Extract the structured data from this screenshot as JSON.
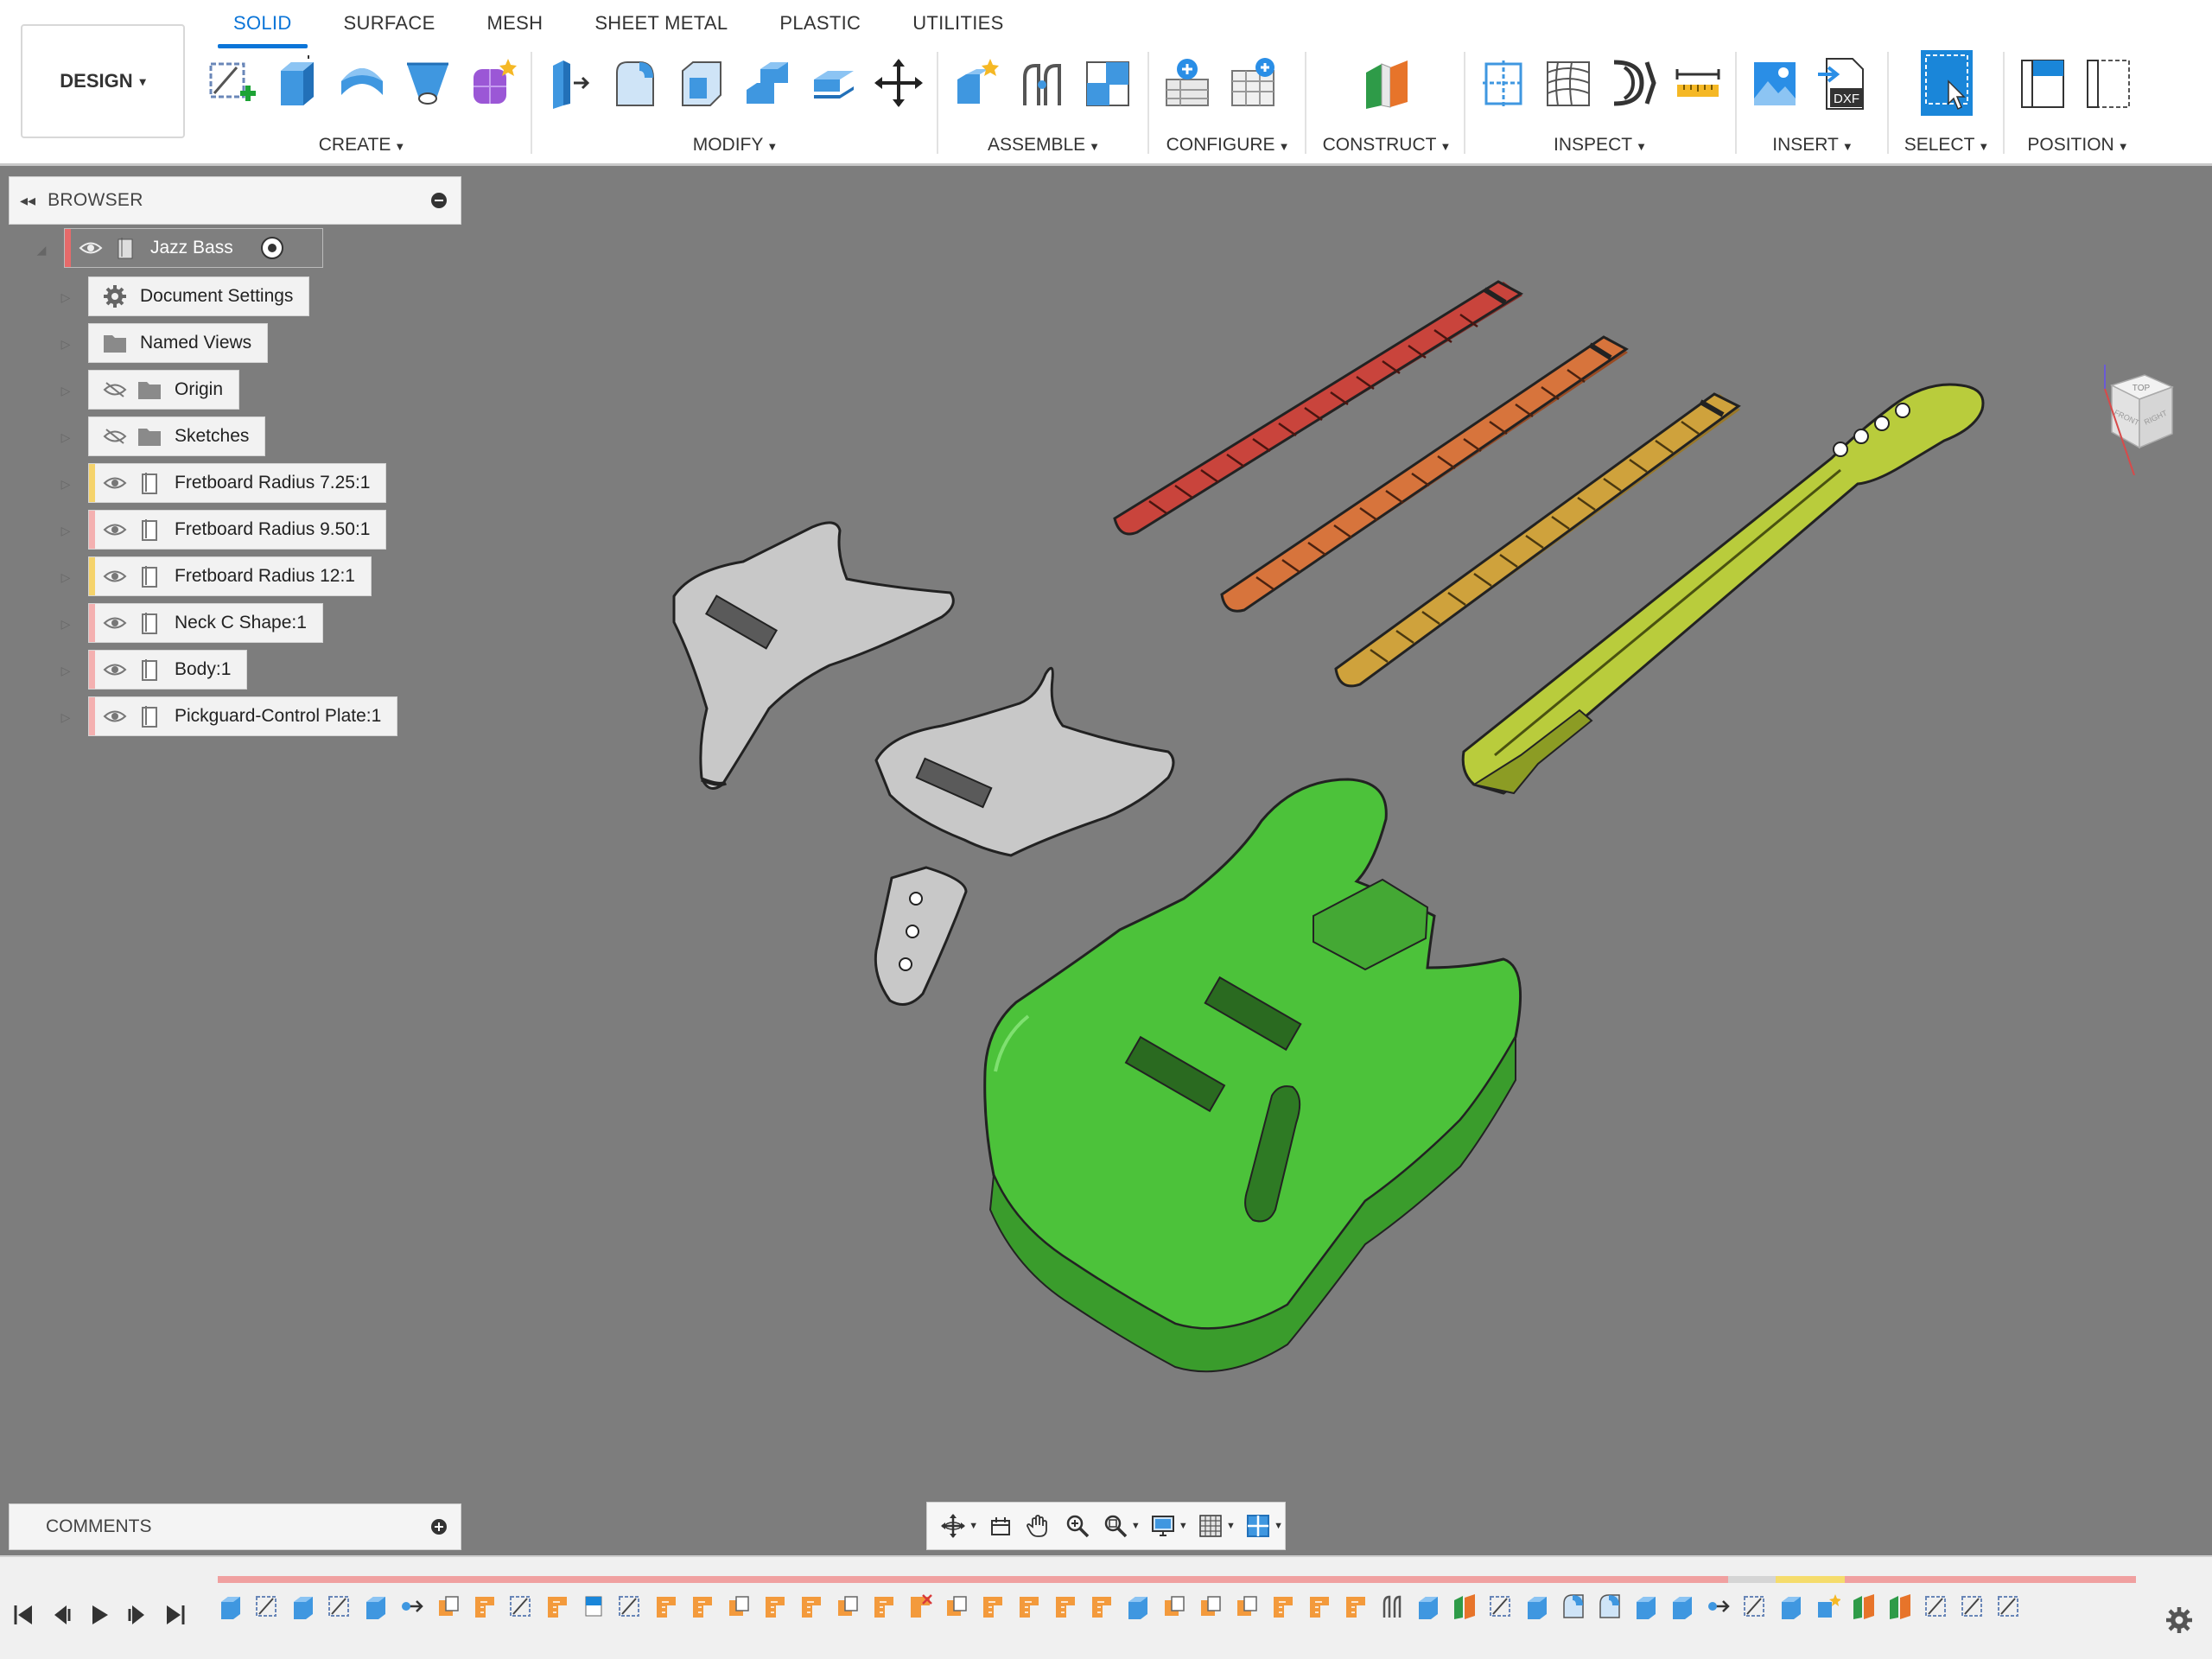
{
  "toolbar": {
    "workspace_label": "DESIGN",
    "tabs": [
      "SOLID",
      "SURFACE",
      "MESH",
      "SHEET METAL",
      "PLASTIC",
      "UTILITIES"
    ],
    "active_tab": "SOLID",
    "groups": {
      "create": "CREATE",
      "modify": "MODIFY",
      "assemble": "ASSEMBLE",
      "configure": "CONFIGURE",
      "construct": "CONSTRUCT",
      "inspect": "INSPECT",
      "insert": "INSERT",
      "select": "SELECT",
      "position": "POSITION"
    },
    "dxf_label": "DXF",
    "accent_color": "#0b75d8"
  },
  "browser": {
    "title": "BROWSER",
    "root": "Jazz Bass",
    "items": [
      {
        "label": "Document Settings",
        "icon": "gear-icon",
        "strip": ""
      },
      {
        "label": "Named Views",
        "icon": "folder-icon",
        "strip": ""
      },
      {
        "label": "Origin",
        "icon": "folder-icon",
        "strip": "",
        "hidden": true
      },
      {
        "label": "Sketches",
        "icon": "folder-icon",
        "strip": "",
        "hidden": true
      },
      {
        "label": "Fretboard Radius 7.25:1",
        "icon": "component-icon",
        "strip": "#f5d36b"
      },
      {
        "label": "Fretboard Radius 9.50:1",
        "icon": "component-icon",
        "strip": "#f4b0b0"
      },
      {
        "label": "Fretboard Radius 12:1",
        "icon": "component-icon",
        "strip": "#f5d36b"
      },
      {
        "label": "Neck C Shape:1",
        "icon": "component-icon",
        "strip": "#f4b0b0"
      },
      {
        "label": "Body:1",
        "icon": "component-icon",
        "strip": "#f4b0b0"
      },
      {
        "label": "Pickguard-Control Plate:1",
        "icon": "component-icon",
        "strip": "#f4b0b0"
      }
    ]
  },
  "comments": {
    "title": "COMMENTS"
  },
  "viewcube": {
    "top": "TOP",
    "front": "FRONT",
    "right": "RIGHT"
  },
  "colors": {
    "canvas_bg": "#7d7d7d",
    "body_green": "#4cc23a",
    "neck_yellow": "#b9cc3c",
    "fretboard_red": "#c9443c",
    "fretboard_orange": "#d7743c",
    "fretboard_tan": "#cfa23c",
    "pickguard_gray": "#c8c8c8"
  }
}
